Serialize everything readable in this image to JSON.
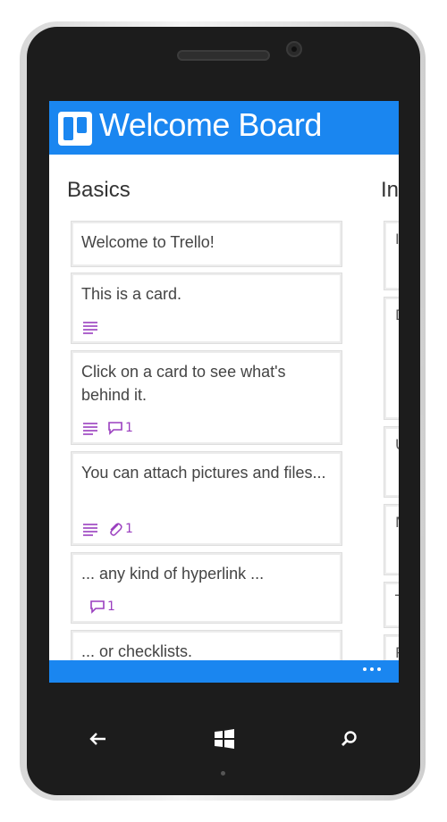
{
  "board": {
    "title": "Welcome Board"
  },
  "lists": [
    {
      "title": "Basics",
      "cards": [
        {
          "text": "Welcome to Trello!",
          "badges": []
        },
        {
          "text": "This is a card.",
          "badges": [
            {
              "icon": "description-icon",
              "count": ""
            }
          ]
        },
        {
          "text": "Click on a card to see what's behind it.",
          "badges": [
            {
              "icon": "description-icon",
              "count": ""
            },
            {
              "icon": "comment-icon",
              "count": "1"
            }
          ]
        },
        {
          "text": "You can attach pictures and files...",
          "badges": [
            {
              "icon": "description-icon",
              "count": ""
            },
            {
              "icon": "attachment-icon",
              "count": "1"
            }
          ]
        },
        {
          "text": "... any kind of hyperlink ...",
          "badges": [
            {
              "icon": "comment-icon",
              "count": "1"
            }
          ]
        },
        {
          "text": "... or checklists.",
          "badges": []
        }
      ]
    },
    {
      "title": "In",
      "peek_cards": [
        "I",
        "D",
        "U",
        "M",
        "T",
        "P"
      ]
    }
  ],
  "appbar": {
    "more_icon": "more-icon"
  },
  "nav": {
    "back_icon": "back-icon",
    "home_icon": "windows-icon",
    "search_icon": "search-icon"
  },
  "colors": {
    "accent": "#1a86f0",
    "badge": "#9a3fbf"
  }
}
